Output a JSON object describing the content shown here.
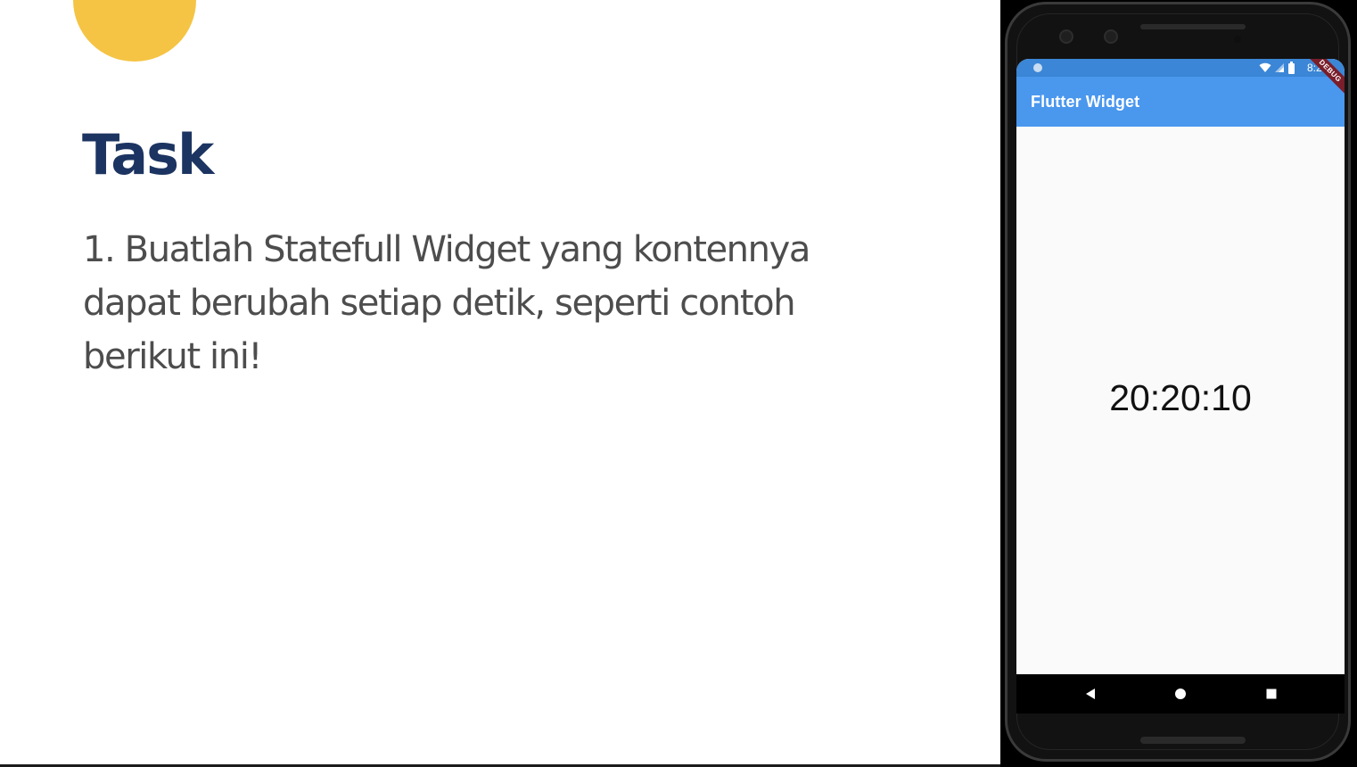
{
  "slide": {
    "title": "Task",
    "task_text": "1. Buatlah Statefull Widget yang kontennya dapat berubah setiap detik, seperti contoh berikut ini!",
    "colors": {
      "title": "#1c3461",
      "body_text": "#4d4d4d",
      "accent_circle": "#f5c444"
    }
  },
  "phone": {
    "status_bar": {
      "time": "8:20",
      "icons": [
        "status-dot-icon",
        "wifi-icon",
        "signal-icon",
        "battery-icon"
      ]
    },
    "app_bar": {
      "title": "Flutter Widget",
      "color": "#4a97ee"
    },
    "debug_banner": "DEBUG",
    "clock": "20:20:10",
    "nav_bar": {
      "buttons": [
        "back-icon",
        "home-icon",
        "recent-apps-icon"
      ]
    }
  }
}
